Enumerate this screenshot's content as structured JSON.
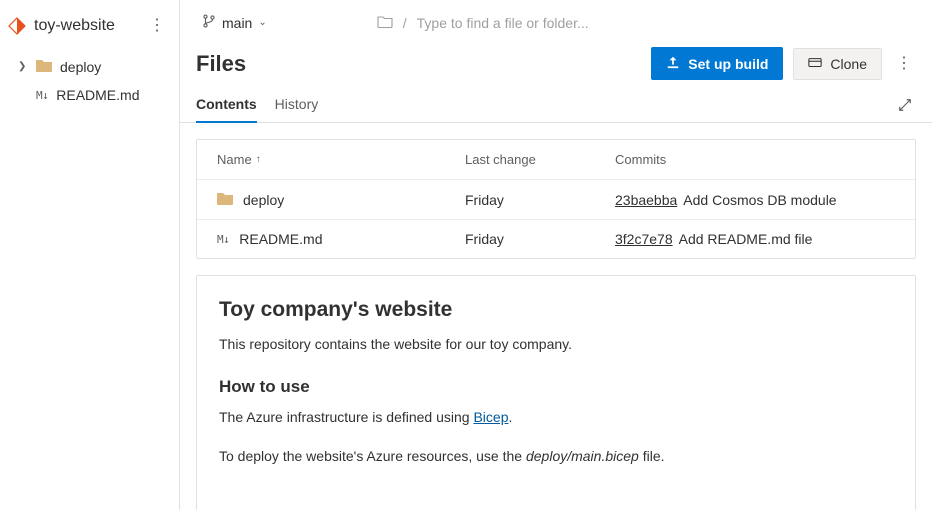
{
  "sidebar": {
    "repo_name": "toy-website",
    "items": [
      {
        "label": "deploy"
      },
      {
        "label": "README.md"
      }
    ]
  },
  "topbar": {
    "branch": "main",
    "search_placeholder": "Type to find a file or folder..."
  },
  "header": {
    "title": "Files",
    "setup_build_label": "Set up build",
    "clone_label": "Clone"
  },
  "tabs": {
    "contents": "Contents",
    "history": "History"
  },
  "table": {
    "headers": {
      "name": "Name",
      "last_change": "Last change",
      "commits": "Commits"
    },
    "rows": [
      {
        "type": "folder",
        "name": "deploy",
        "last_change": "Friday",
        "hash": "23baebba",
        "message": "Add Cosmos DB module"
      },
      {
        "type": "md",
        "name": "README.md",
        "last_change": "Friday",
        "hash": "3f2c7e78",
        "message": "Add README.md file"
      }
    ]
  },
  "readme": {
    "title": "Toy company's website",
    "intro": "This repository contains the website for our toy company.",
    "howto_heading": "How to use",
    "howto_prefix": "The Azure infrastructure is defined using ",
    "howto_link": "Bicep",
    "howto_suffix": ".",
    "deploy_prefix": "To deploy the website's Azure resources, use the ",
    "deploy_file": "deploy/main.bicep",
    "deploy_suffix": " file."
  }
}
